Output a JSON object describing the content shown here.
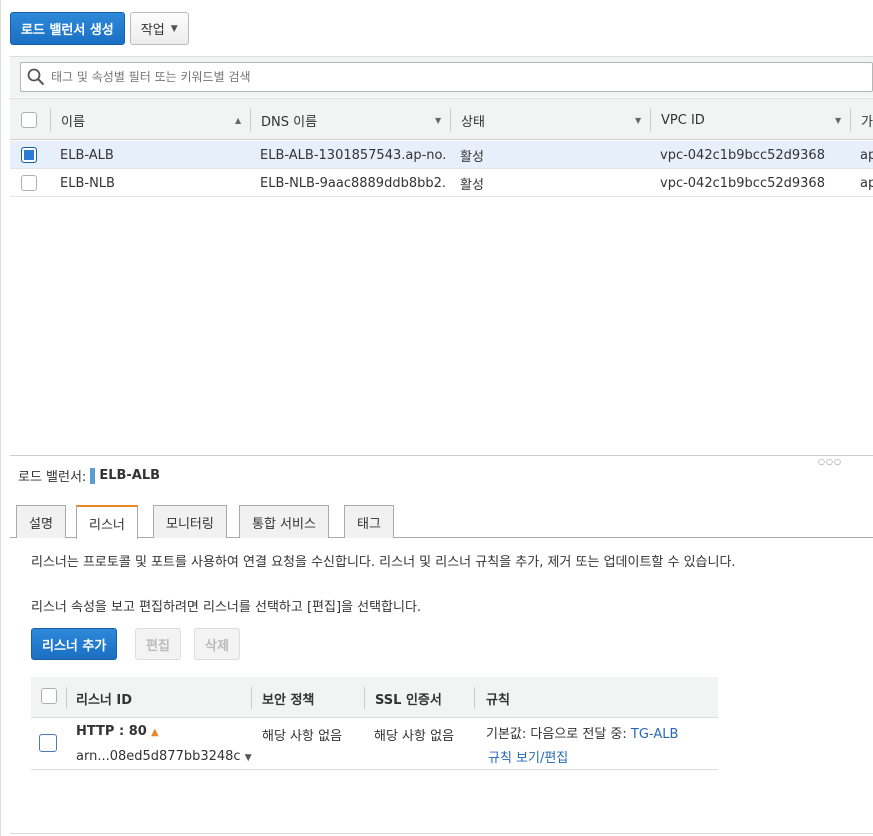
{
  "toolbar": {
    "create_label": "로드 밸런서 생성",
    "actions_label": "작업"
  },
  "search": {
    "placeholder": "태그 및 속성별 필터 또는 키워드별 검색"
  },
  "table": {
    "columns": [
      "이름",
      "DNS 이름",
      "상태",
      "VPC ID",
      "가"
    ],
    "rows": [
      {
        "name": "ELB-ALB",
        "dns": "ELB-ALB-1301857543.ap-no...",
        "state": "활성",
        "vpc": "vpc-042c1b9bcc52d9368",
        "extra": "ap",
        "selected": true
      },
      {
        "name": "ELB-NLB",
        "dns": "ELB-NLB-9aac8889ddb8bb2...",
        "state": "활성",
        "vpc": "vpc-042c1b9bcc52d9368",
        "extra": "ap",
        "selected": false
      }
    ]
  },
  "detail": {
    "prefix": "로드 밸런서:",
    "name": "ELB-ALB",
    "tabs": [
      "설명",
      "리스너",
      "모니터링",
      "통합 서비스",
      "태그"
    ],
    "active_tab": "리스너",
    "desc1": "리스너는 프로토콜 및 포트를 사용하여 연결 요청을 수신합니다. 리스너 및 리스너 규칙을 추가, 제거 또는 업데이트할 수 있습니다.",
    "desc2": "리스너 속성을 보고 편집하려면 리스너를 선택하고 [편집]을 선택합니다.",
    "buttons": {
      "add": "리스너 추가",
      "edit": "편집",
      "delete": "삭제"
    }
  },
  "listeners": {
    "columns": [
      "리스너 ID",
      "보안 정책",
      "SSL 인증서",
      "규칙"
    ],
    "rows": [
      {
        "protocol": "HTTP : 80",
        "arn": "arn...08ed5d877bb3248c",
        "policy": "해당 사항 없음",
        "ssl": "해당 사항 없음",
        "rule_default_label": "기본값:",
        "rule_forward": "다음으로 전달 중:",
        "rule_target": "TG-ALB",
        "rule_link": "규칙 보기/편집"
      }
    ]
  }
}
